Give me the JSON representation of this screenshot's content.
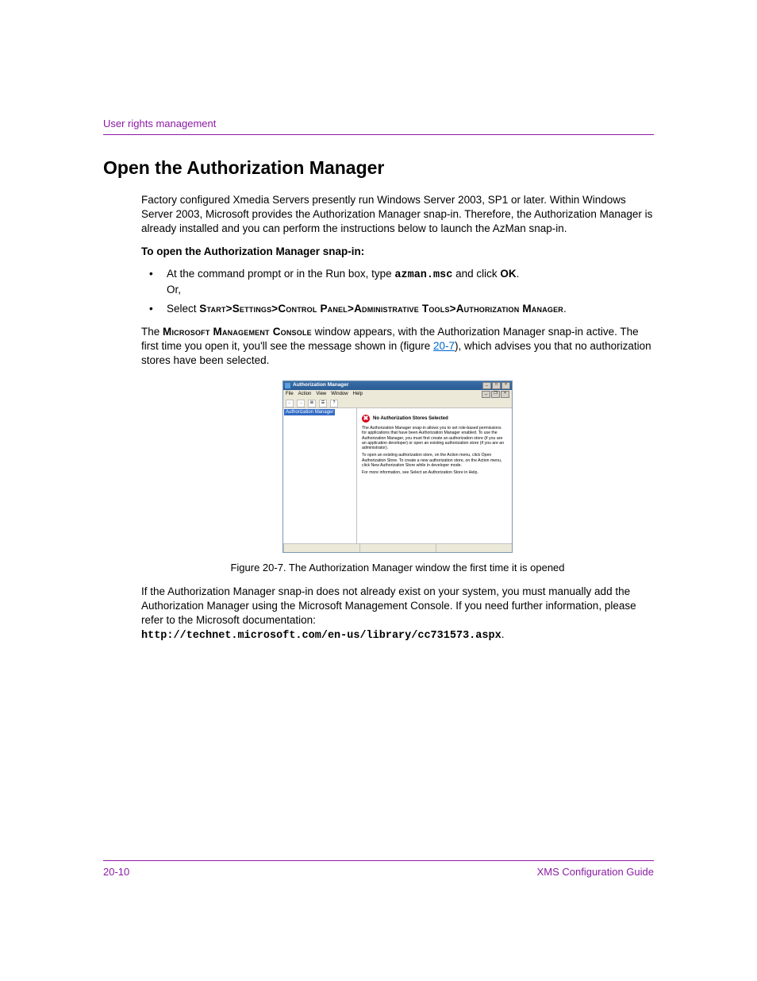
{
  "header": {
    "section_title": "User rights management"
  },
  "heading": "Open the Authorization Manager",
  "intro": "Factory configured Xmedia Servers presently run Windows Server 2003, SP1 or later. Within Windows Server 2003, Microsoft provides the Authorization Manager snap-in. Therefore, the Authorization Manager is already installed and you can perform the instructions below to launch the AzMan snap-in.",
  "procedure_title": "To open the Authorization Manager snap-in:",
  "bullet1": {
    "prefix": "At the command prompt or in the Run box, type ",
    "cmd": "azman.msc",
    "mid": " and click ",
    "ok": "OK",
    "suffix": ".",
    "or": "Or,"
  },
  "bullet2": {
    "prefix": "Select ",
    "path": "Start>Settings>Control Panel>Administrative Tools>Authorization Manager",
    "suffix": "."
  },
  "result": {
    "pre": "The ",
    "mmc": "Microsoft Management Console",
    "mid1": " window appears, with the Authorization Manager snap-in active. The first time you open it, you'll see the message shown in (figure ",
    "figref": "20-7",
    "mid2": "), which advises you that no authorization stores have been selected."
  },
  "screenshot": {
    "window_title": "Authorization Manager",
    "menus": [
      "File",
      "Action",
      "View",
      "Window",
      "Help"
    ],
    "tree_root": "Authorization Manager",
    "msg_title": "No Authorization Stores Selected",
    "msg_p1": "The Authorization Manager snap-in allows you to set role-based permissions for applications that have been Authorization Manager enabled. To use the Authorization Manager, you must first create an authorization store (if you are an application developer) or open an existing authorization store (if you are an administrator).",
    "msg_p2": "To open an existing authorization store, on the Action menu, click Open Authorization Store. To create a new authorization store, on the Action menu, click New Authorization Store while in developer mode.",
    "msg_p3": "For more information, see Select an Authorization Store in Help."
  },
  "figure_caption": "Figure 20-7. The Authorization Manager window the first time it is opened",
  "post_figure": {
    "text": "If the Authorization Manager snap-in does not already exist on your system, you must manually add the Authorization Manager using the Microsoft Management Console. If you need further information, please refer to the Microsoft documentation: ",
    "url": "http://technet.microsoft.com/en-us/library/cc731573.aspx",
    "suffix": "."
  },
  "footer": {
    "page_number": "20-10",
    "doc_title": "XMS Configuration Guide"
  }
}
